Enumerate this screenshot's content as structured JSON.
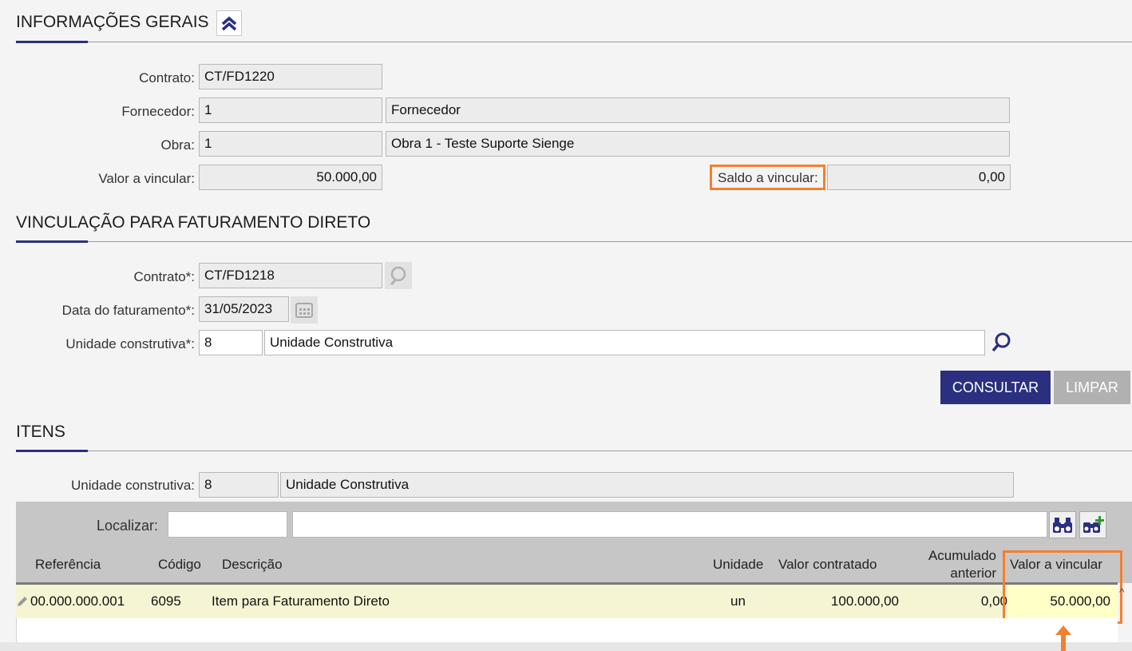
{
  "info": {
    "title": "INFORMAÇÕES GERAIS",
    "contrato_label": "Contrato:",
    "contrato_value": "CT/FD1220",
    "fornecedor_label": "Fornecedor:",
    "fornecedor_code": "1",
    "fornecedor_name": "Fornecedor",
    "obra_label": "Obra:",
    "obra_code": "1",
    "obra_name": "Obra 1 - Teste Suporte Sienge",
    "valor_label": "Valor a vincular:",
    "valor_value": "50.000,00",
    "saldo_label": "Saldo a vincular:",
    "saldo_value": "0,00"
  },
  "vinc": {
    "title": "VINCULAÇÃO PARA FATURAMENTO DIRETO",
    "contrato_label": "Contrato*:",
    "contrato_value": "CT/FD1218",
    "data_label": "Data do faturamento*:",
    "data_value": "31/05/2023",
    "unidade_label": "Unidade construtiva*:",
    "unidade_code": "8",
    "unidade_name": "Unidade Construtiva",
    "consultar_label": "CONSULTAR",
    "limpar_label": "LIMPAR"
  },
  "itens": {
    "title": "ITENS",
    "unidade_label": "Unidade construtiva:",
    "unidade_code": "8",
    "unidade_name": "Unidade Construtiva",
    "localizar_label": "Localizar:",
    "localizar_value": "",
    "localizar_text": "",
    "columns": {
      "referencia": "Referência",
      "codigo": "Código",
      "descricao": "Descrição",
      "unidade": "Unidade",
      "valor_contratado": "Valor contratado",
      "acumulado_1": "Acumulado",
      "acumulado_2": "anterior",
      "valor_vincular": "Valor a vincular"
    },
    "rows": [
      {
        "referencia": "00.000.000.001",
        "codigo": "6095",
        "descricao": "Item para Faturamento Direto",
        "unidade": "un",
        "valor_contratado": "100.000,00",
        "acumulado": "0,00",
        "valor_vincular": "50.000,00"
      }
    ]
  },
  "colors": {
    "primary": "#2a2f7f",
    "highlight": "#f28030",
    "row_bg": "#f5f5d4"
  }
}
